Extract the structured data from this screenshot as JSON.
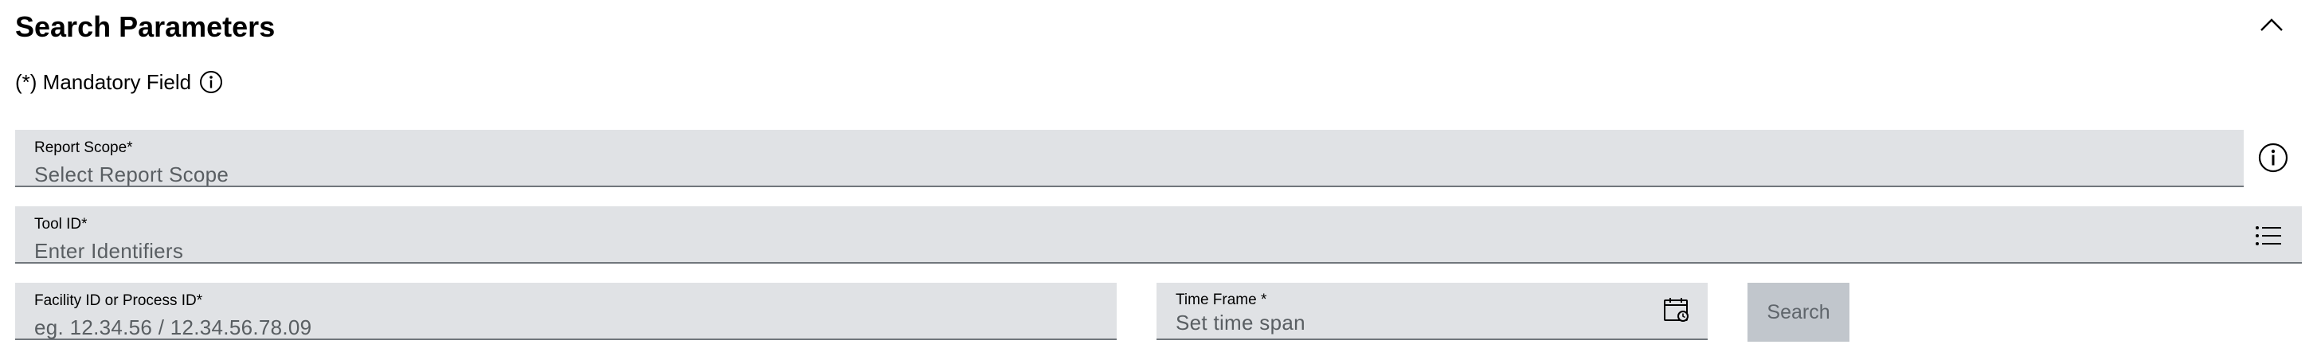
{
  "section": {
    "title": "Search Parameters",
    "mandatory_note": "(*) Mandatory Field"
  },
  "fields": {
    "report_scope": {
      "label": "Report Scope*",
      "placeholder": "Select Report Scope"
    },
    "tool_id": {
      "label": "Tool ID*",
      "placeholder": "Enter Identifiers"
    },
    "facility_id": {
      "label": "Facility ID or Process ID*",
      "placeholder": "eg. 12.34.56 / 12.34.56.78.09"
    },
    "time_frame": {
      "label": "Time Frame *",
      "placeholder": "Set time span"
    }
  },
  "actions": {
    "search_label": "Search"
  },
  "icons": {
    "collapse": "chevron-up-icon",
    "mandatory_info": "info-icon",
    "report_scope_info": "info-icon",
    "tool_id_list": "list-icon",
    "calendar": "calendar-icon"
  }
}
